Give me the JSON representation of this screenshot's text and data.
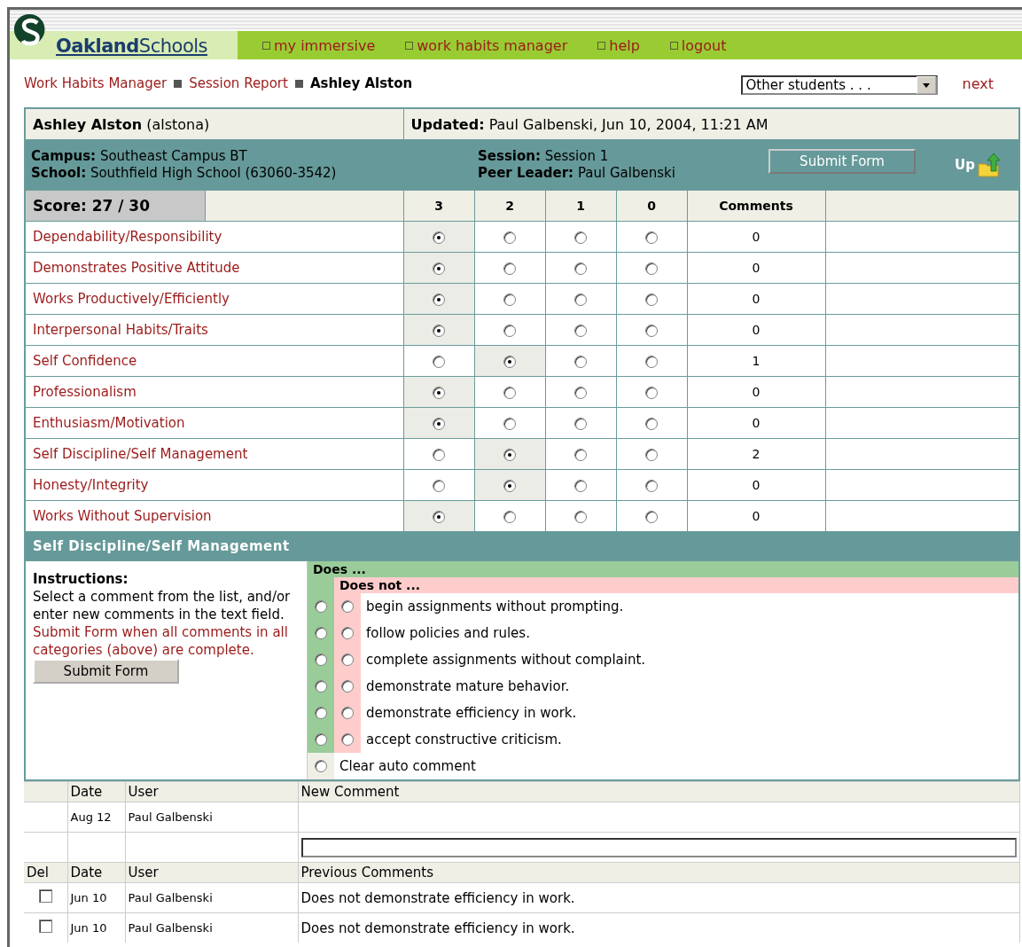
{
  "logo": {
    "text": "**Oakland**Schools"
  },
  "nav": [
    {
      "label": "my immersive"
    },
    {
      "label": "work habits manager"
    },
    {
      "label": "help"
    },
    {
      "label": "logout"
    }
  ],
  "breadcrumb": [
    {
      "label": "Work Habits Manager",
      "current": false
    },
    {
      "label": "Session Report",
      "current": false
    },
    {
      "label": "Ashley Alston",
      "current": true
    }
  ],
  "student_select": {
    "value": "Other students . . ."
  },
  "next_link": "next",
  "student": {
    "name": "Ashley Alston",
    "username": "(alstona)",
    "updated_label": "Updated:",
    "updated": "Paul Galbenski, Jun 10, 2004, 11:21 AM"
  },
  "info": {
    "campus_label": "Campus:",
    "campus": "Southeast Campus BT",
    "school_label": "School:",
    "school": "Southfield High School (63060-3542)",
    "session_label": "Session:",
    "session": "Session 1",
    "leader_label": "Peer Leader:",
    "leader": "Paul Galbenski",
    "submit": "Submit Form",
    "up": "Up"
  },
  "score": "Score: 27 / 30",
  "columns": [
    "3",
    "2",
    "1",
    "0",
    "Comments"
  ],
  "ratings": [
    {
      "label": "Dependability/Responsibility",
      "comments": "0",
      "options": [
        {
          "selected": true
        },
        {
          "selected": false
        },
        {
          "selected": false
        },
        {
          "selected": false
        }
      ]
    },
    {
      "label": "Demonstrates Positive Attitude",
      "comments": "0",
      "options": [
        {
          "selected": true
        },
        {
          "selected": false
        },
        {
          "selected": false
        },
        {
          "selected": false
        }
      ]
    },
    {
      "label": "Works Productively/Efficiently",
      "comments": "0",
      "options": [
        {
          "selected": true
        },
        {
          "selected": false
        },
        {
          "selected": false
        },
        {
          "selected": false
        }
      ]
    },
    {
      "label": "Interpersonal Habits/Traits",
      "comments": "0",
      "options": [
        {
          "selected": true
        },
        {
          "selected": false
        },
        {
          "selected": false
        },
        {
          "selected": false
        }
      ]
    },
    {
      "label": "Self Confidence",
      "comments": "1",
      "options": [
        {
          "selected": false
        },
        {
          "selected": true
        },
        {
          "selected": false
        },
        {
          "selected": false
        }
      ]
    },
    {
      "label": "Professionalism",
      "comments": "0",
      "options": [
        {
          "selected": true
        },
        {
          "selected": false
        },
        {
          "selected": false
        },
        {
          "selected": false
        }
      ]
    },
    {
      "label": "Enthusiasm/Motivation",
      "comments": "0",
      "options": [
        {
          "selected": true
        },
        {
          "selected": false
        },
        {
          "selected": false
        },
        {
          "selected": false
        }
      ]
    },
    {
      "label": "Self Discipline/Self Management",
      "comments": "2",
      "options": [
        {
          "selected": false
        },
        {
          "selected": true
        },
        {
          "selected": false
        },
        {
          "selected": false
        }
      ]
    },
    {
      "label": "Honesty/Integrity",
      "comments": "0",
      "options": [
        {
          "selected": false
        },
        {
          "selected": true
        },
        {
          "selected": false
        },
        {
          "selected": false
        }
      ]
    },
    {
      "label": "Works Without Supervision",
      "comments": "0",
      "options": [
        {
          "selected": true
        },
        {
          "selected": false
        },
        {
          "selected": false
        },
        {
          "selected": false
        }
      ]
    }
  ],
  "detail": {
    "title": "Self Discipline/Self Management",
    "instructions_title": "Instructions:",
    "instructions": "Select a comment from the list, and/or enter new comments in the text field.",
    "instructions_note": "Submit Form when all comments in all categories (above) are complete.",
    "submit": "Submit Form",
    "does_label": "Does ...",
    "does_not_label": "Does not ...",
    "choices": [
      {
        "text": "begin assignments without prompting.",
        "does": false,
        "does_not": false
      },
      {
        "text": "follow policies and rules.",
        "does": false,
        "does_not": false
      },
      {
        "text": "complete assignments without complaint.",
        "does": false,
        "does_not": false
      },
      {
        "text": "demonstrate mature behavior.",
        "does": false,
        "does_not": false
      },
      {
        "text": "demonstrate efficiency in work.",
        "does": false,
        "does_not": false
      },
      {
        "text": "accept constructive criticism.",
        "does": false,
        "does_not": false
      }
    ],
    "clear": {
      "text": "Clear auto comment",
      "selected": false
    }
  },
  "new_comment": {
    "headers": [
      "Date",
      "User",
      "New Comment"
    ],
    "date": "Aug 12",
    "user": "Paul Galbenski"
  },
  "previous": {
    "headers": [
      "Del",
      "Date",
      "User",
      "Previous Comments"
    ],
    "rows": [
      {
        "checked": false,
        "date": "Jun 10",
        "user": "Paul Galbenski",
        "comment": "Does not demonstrate efficiency in work."
      },
      {
        "checked": false,
        "date": "Jun 10",
        "user": "Paul Galbenski",
        "comment": "Does not demonstrate efficiency in work."
      }
    ]
  }
}
